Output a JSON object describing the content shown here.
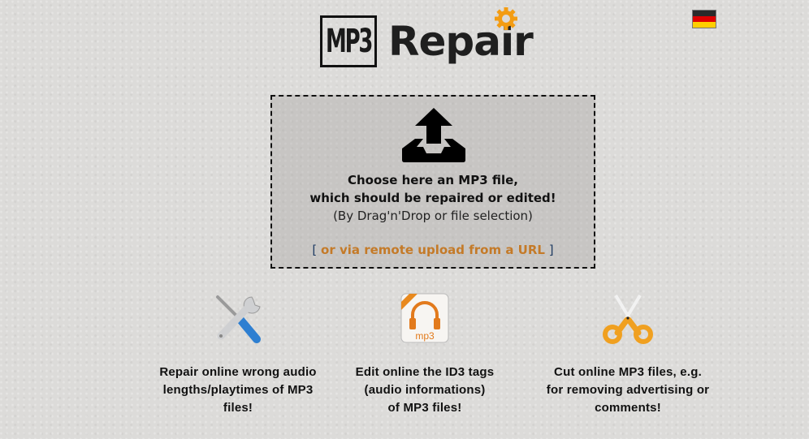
{
  "header": {
    "logo_part1": "MP3",
    "logo_part2": "Repair",
    "language_flag": "german-flag",
    "colors": {
      "gear": "#f39c12",
      "flag_black": "#222222",
      "flag_red": "#dd0000",
      "flag_gold": "#ffce00"
    }
  },
  "dropzone": {
    "icon": "upload-icon",
    "line1": "Choose here an MP3 file,",
    "line2": "which should be repaired or edited!",
    "line3": "(By Drag'n'Drop or file selection)",
    "bracket_open": "[",
    "url_link": "or via remote upload from a URL",
    "bracket_close": "]",
    "colors": {
      "link": "#c47a28"
    }
  },
  "features": [
    {
      "icon": "tools-icon",
      "label_lines": [
        "Repair online wrong audio",
        "lengths/playtimes of MP3",
        "files!"
      ]
    },
    {
      "icon": "mp3-headphones-icon",
      "label_lines": [
        "Edit online the ID3 tags",
        "(audio informations)",
        "of MP3 files!"
      ]
    },
    {
      "icon": "scissors-icon",
      "label_lines": [
        "Cut online MP3 files, e.g.",
        "for removing advertising or",
        "comments!"
      ]
    }
  ]
}
